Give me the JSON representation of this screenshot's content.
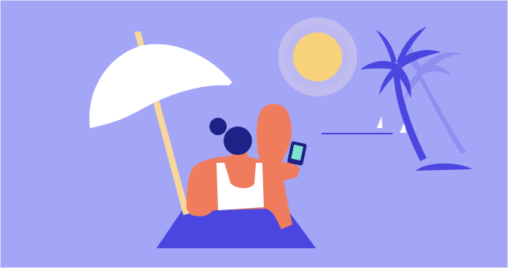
{
  "scene": {
    "background_color": "#A3A6F6",
    "frame_border_color": "#D9D9F5",
    "sun_color": "#F8D27A",
    "sun_glow_color": "#C9C3EC",
    "umbrella_canopy_color": "#FFFFFF",
    "umbrella_pole_color": "#F7D79A",
    "towel_color": "#4B46E0",
    "skin_color": "#F07C5E",
    "hair_color": "#1E2185",
    "top_color": "#FFFFFF",
    "phone_color": "#1E2185",
    "phone_screen_color": "#7FE3D0",
    "palm_front_color": "#4B46E0",
    "palm_back_color": "#8E8CF0",
    "sail_color": "#FFFFFF",
    "horizon_color": "#4B46E0",
    "icons": [
      "umbrella-icon",
      "sun-icon",
      "palm-tree-icon",
      "sailboat-icon",
      "phone-icon"
    ]
  }
}
